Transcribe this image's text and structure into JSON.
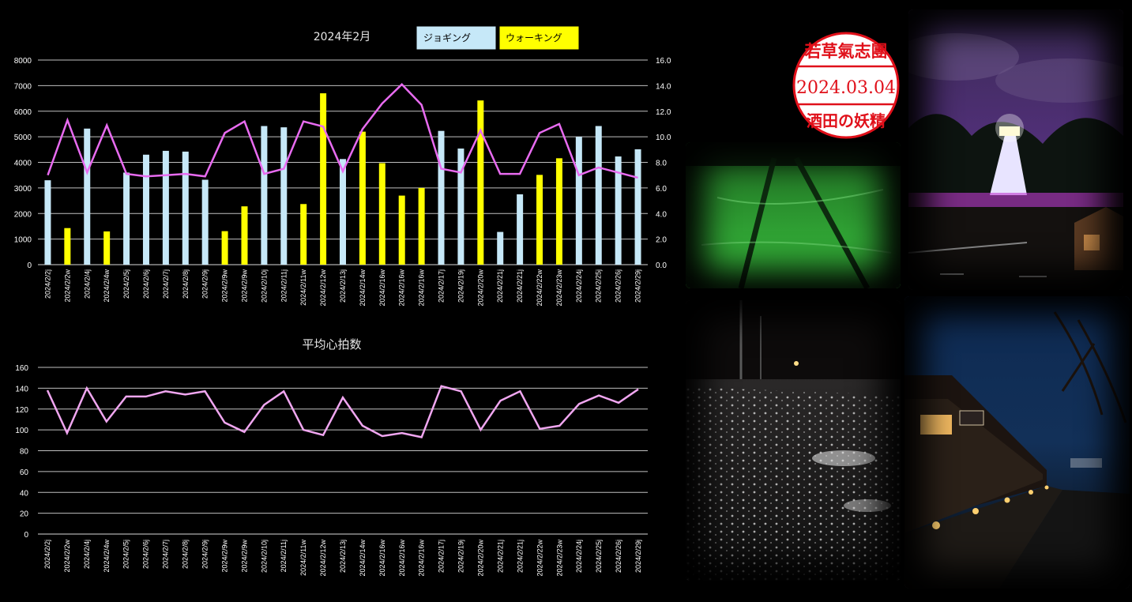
{
  "chart_data": [
    {
      "type": "bar",
      "title": "2024年2月",
      "legend": {
        "placement": "top-center"
      },
      "categories": [
        "2024/2/2j",
        "2024/2/2w",
        "2024/2/4j",
        "2024/2/4w",
        "2024/2/5j",
        "2024/2/6j",
        "2024/2/7j",
        "2024/2/8j",
        "2024/2/9j",
        "2024/2/9w",
        "2024/2/9w",
        "2024/2/10j",
        "2024/2/11j",
        "2024/2/11w",
        "2024/2/12w",
        "2024/2/13j",
        "2024/2/14w",
        "2024/2/16w",
        "2024/2/16w",
        "2024/2/16w",
        "2024/2/17j",
        "2024/2/19j",
        "2024/2/20w",
        "2024/2/21j",
        "2024/2/21j",
        "2024/2/22w",
        "2024/2/23w",
        "2024/2/24j",
        "2024/2/25j",
        "2024/2/26j",
        "2024/2/29j"
      ],
      "series": [
        {
          "name": "ジョギング",
          "color": "#c6e8f8",
          "kind": "bar",
          "axis": "left",
          "values": [
            3300,
            null,
            5320,
            null,
            3600,
            4300,
            4450,
            4420,
            3320,
            null,
            null,
            5420,
            5370,
            null,
            null,
            4130,
            null,
            null,
            null,
            null,
            5230,
            4540,
            null,
            1280,
            2750,
            null,
            null,
            5000,
            5420,
            4230,
            4510
          ]
        },
        {
          "name": "ウォーキング",
          "color": "#ffff00",
          "kind": "bar",
          "axis": "left",
          "values": [
            null,
            1430,
            null,
            1300,
            null,
            null,
            null,
            null,
            null,
            1310,
            2280,
            null,
            null,
            2370,
            6700,
            null,
            5200,
            3970,
            2700,
            3000,
            null,
            null,
            6420,
            null,
            null,
            3510,
            4160,
            null,
            null,
            null,
            null
          ]
        },
        {
          "color": "#e86bf0",
          "kind": "line",
          "axis": "right",
          "values": [
            7.0,
            11.3,
            7.2,
            10.9,
            7.1,
            6.9,
            7.0,
            7.1,
            6.9,
            10.3,
            11.2,
            7.1,
            7.5,
            11.2,
            10.8,
            7.3,
            10.6,
            12.6,
            14.1,
            12.5,
            7.5,
            7.2,
            10.5,
            7.1,
            7.1,
            10.3,
            11.0,
            7.0,
            7.6,
            7.2,
            6.8
          ]
        }
      ],
      "ylim": [
        0,
        8000
      ],
      "yticks": [
        0,
        1000,
        2000,
        3000,
        4000,
        5000,
        6000,
        7000,
        8000
      ],
      "y2lim": [
        0,
        16
      ],
      "y2ticks": [
        "0.0",
        "2.0",
        "4.0",
        "6.0",
        "8.0",
        "10.0",
        "12.0",
        "14.0",
        "16.0"
      ],
      "grid": true
    },
    {
      "type": "line",
      "title": "平均心拍数",
      "categories": [
        "2024/2/2j",
        "2024/2/2w",
        "2024/2/4j",
        "2024/2/4w",
        "2024/2/5j",
        "2024/2/6j",
        "2024/2/7j",
        "2024/2/8j",
        "2024/2/9j",
        "2024/2/9w",
        "2024/2/9w",
        "2024/2/10j",
        "2024/2/11j",
        "2024/2/11w",
        "2024/2/12w",
        "2024/2/13j",
        "2024/2/14w",
        "2024/2/16w",
        "2024/2/16w",
        "2024/2/16w",
        "2024/2/17j",
        "2024/2/19j",
        "2024/2/20w",
        "2024/2/21j",
        "2024/2/21j",
        "2024/2/22w",
        "2024/2/23w",
        "2024/2/24j",
        "2024/2/25j",
        "2024/2/26j",
        "2024/2/29j"
      ],
      "series": [
        {
          "color": "#f0a6f0",
          "values": [
            138,
            97,
            140,
            108,
            132,
            132,
            137,
            134,
            137,
            107,
            98,
            124,
            137,
            100,
            95,
            131,
            104,
            94,
            97,
            93,
            142,
            137,
            100,
            128,
            137,
            101,
            104,
            125,
            133,
            126,
            139
          ]
        }
      ],
      "ylim": [
        0,
        160
      ],
      "yticks": [
        0,
        20,
        40,
        60,
        80,
        100,
        120,
        140,
        160
      ],
      "grid": true
    }
  ],
  "stamp": {
    "top_text": "若草氣志團",
    "date": "2024.03.04",
    "bottom_text": "酒田の妖精",
    "color": "#e0101a"
  },
  "photos": [
    {
      "name": "green-lit-rail-track-in-snow"
    },
    {
      "name": "illuminated-lighthouse-at-night"
    },
    {
      "name": "wet-snowy-road-at-night"
    },
    {
      "name": "lit-warehouse-row-at-night"
    }
  ]
}
